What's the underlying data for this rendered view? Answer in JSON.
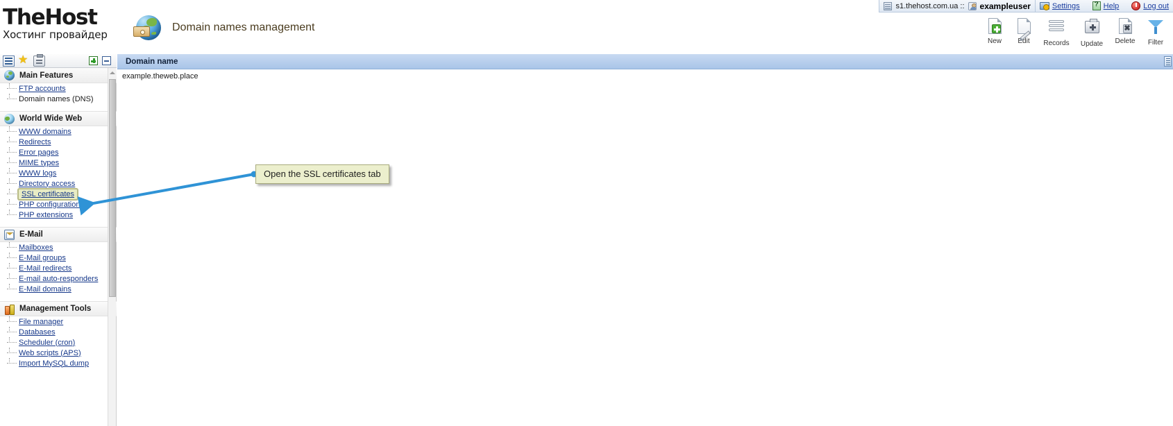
{
  "topbar": {
    "server_icon": "server-icon",
    "server": "s1.thehost.com.ua ::",
    "user_icon": "person-icon",
    "username": "exampleuser",
    "links": [
      {
        "icon": "settings-icon",
        "label": "Settings"
      },
      {
        "icon": "help-icon",
        "label": "Help"
      },
      {
        "icon": "logout-icon",
        "label": "Log out"
      }
    ]
  },
  "brand": {
    "name": "TheHost",
    "tagline": "Хостинг провайдер",
    "logo_icon": "globe-box-icon"
  },
  "header": {
    "page_icon": "domain-globe-icon",
    "title": "Domain names management"
  },
  "toolbar": {
    "actions": [
      {
        "label": "New",
        "icon": "new-page-icon"
      },
      {
        "label": "Edit",
        "icon": "edit-pencil-icon"
      },
      {
        "label": "Records",
        "icon": "records-stack-icon"
      },
      {
        "label": "Update",
        "icon": "update-medkit-icon"
      },
      {
        "label": "Delete",
        "icon": "delete-page-icon"
      },
      {
        "label": "Filter",
        "icon": "filter-funnel-icon"
      }
    ]
  },
  "sidebar": {
    "tools": [
      {
        "icon": "list-view-icon"
      },
      {
        "icon": "favorites-star-icon"
      },
      {
        "icon": "clipboard-icon"
      }
    ],
    "tree_controls": [
      {
        "icon": "expand-all-icon"
      },
      {
        "icon": "collapse-all-icon"
      }
    ],
    "sections": [
      {
        "title": "Main Features",
        "icon": "main-features-globe-icon",
        "items": [
          {
            "label": "FTP accounts",
            "current": false
          },
          {
            "label": "Domain names (DNS)",
            "current": true
          }
        ]
      },
      {
        "title": "World Wide Web",
        "icon": "www-globe-icon",
        "items": [
          {
            "label": "WWW domains",
            "current": false
          },
          {
            "label": "Redirects",
            "current": false
          },
          {
            "label": "Error pages",
            "current": false
          },
          {
            "label": "MIME types",
            "current": false
          },
          {
            "label": "WWW logs",
            "current": false
          },
          {
            "label": "Directory access",
            "current": false
          },
          {
            "label": "SSL certificates",
            "current": false,
            "highlight": true
          },
          {
            "label": "PHP configuration",
            "current": false
          },
          {
            "label": "PHP extensions",
            "current": false
          }
        ]
      },
      {
        "title": "E-Mail",
        "icon": "email-icon",
        "items": [
          {
            "label": "Mailboxes",
            "current": false
          },
          {
            "label": "E-Mail groups",
            "current": false
          },
          {
            "label": "E-Mail redirects",
            "current": false
          },
          {
            "label": "E-mail auto-responders",
            "current": false
          },
          {
            "label": "E-Mail domains",
            "current": false
          }
        ]
      },
      {
        "title": "Management Tools",
        "icon": "management-tools-icon",
        "items": [
          {
            "label": "File manager",
            "current": false
          },
          {
            "label": "Databases",
            "current": false
          },
          {
            "label": "Scheduler (cron)",
            "current": false
          },
          {
            "label": "Web scripts (APS)",
            "current": false
          },
          {
            "label": "Import MySQL dump",
            "current": false
          }
        ]
      }
    ],
    "scrollbar": {
      "up_icon": "scroll-up-arrow-icon"
    }
  },
  "content": {
    "column_header": "Domain name",
    "column_options_icon": "column-options-icon",
    "rows": [
      {
        "domain": "example.theweb.place"
      }
    ]
  },
  "annotation": {
    "callout_text": "Open the SSL certificates tab",
    "arrow_color": "#2f93d6",
    "callout_bg": "#ecefcd",
    "callout_border": "#a8ab7d"
  }
}
